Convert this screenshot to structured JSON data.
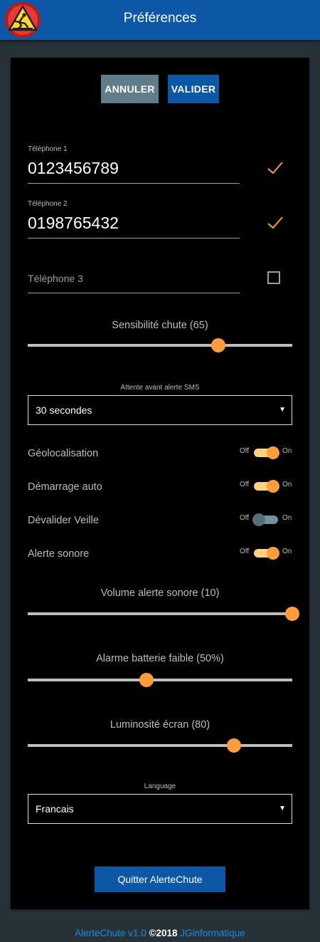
{
  "header": {
    "title": "Préférences",
    "logo_icon": "fall-warning-icon"
  },
  "actions": {
    "cancel_label": "ANNULER",
    "ok_label": "VALIDER"
  },
  "phones": [
    {
      "label": "Téléphone 1",
      "value": "0123456789",
      "checked": true
    },
    {
      "label": "Téléphone 2",
      "value": "0198765432",
      "checked": true
    },
    {
      "placeholder": "Téléphone 3",
      "value": "",
      "checked": false
    }
  ],
  "sliders": [
    {
      "label": "Sensibilité chute (65)",
      "value": 65,
      "fraction": 0.72
    },
    {
      "label": "Volume alerte sonore (10)",
      "value": 10,
      "fraction": 1.0
    },
    {
      "label": "Alarme batterie faible (50%)",
      "value": 50,
      "fraction": 0.45
    },
    {
      "label": "Luminosité écran (80)",
      "value": 80,
      "fraction": 0.78
    }
  ],
  "sms_delay": {
    "caption": "Attente avant alerte SMS",
    "selected": "30 secondes"
  },
  "toggles": [
    {
      "label": "Géolocalisation",
      "off_label": "Off",
      "on_label": "On",
      "on": true
    },
    {
      "label": "Démarrage auto",
      "off_label": "Off",
      "on_label": "On",
      "on": true
    },
    {
      "label": "Dévalider Veille",
      "off_label": "Off",
      "on_label": "On",
      "on": false
    },
    {
      "label": "Alerte sonore",
      "off_label": "Off",
      "on_label": "On",
      "on": true
    }
  ],
  "language": {
    "caption": "Language",
    "selected": "Francais"
  },
  "quit_label": "Quitter AlerteChute",
  "footer": {
    "app": "AlerteChute v1.0",
    "copyright": "©2018",
    "company": "JGinformatique"
  },
  "colors": {
    "header": "#0d58a6",
    "accent": "#ff9d3d",
    "background": "#263238",
    "card": "#000000",
    "link": "#1e88e5"
  }
}
